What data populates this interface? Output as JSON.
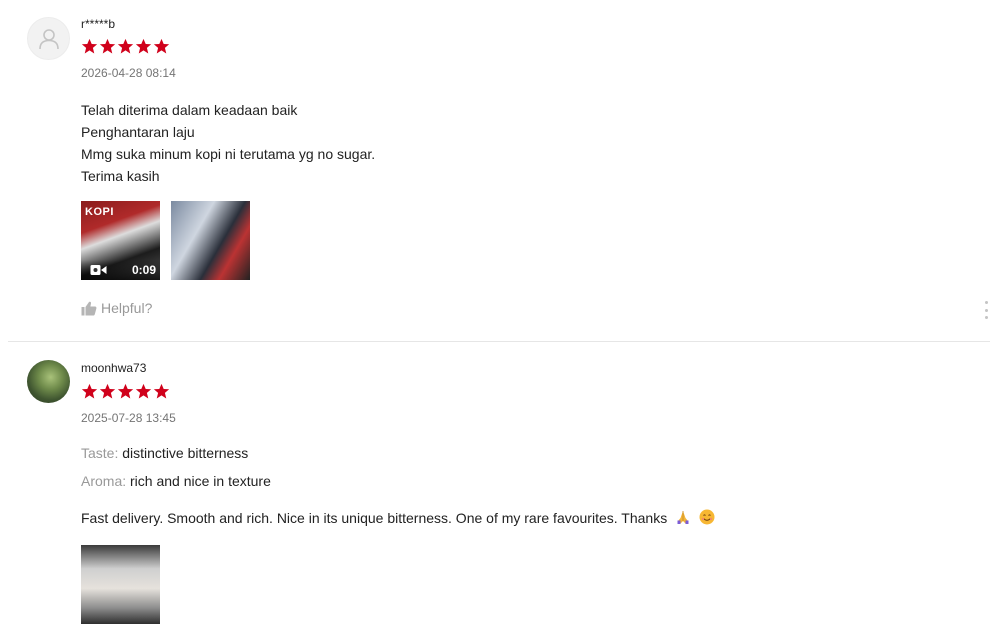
{
  "reviews": [
    {
      "username": "r*****b",
      "rating": 5,
      "date": "2026-04-28 08:14",
      "comment_lines": [
        "Telah diterima dalam keadaan baik",
        "Penghantaran laju",
        "Mmg suka minum kopi ni terutama yg no sugar.",
        "Terima kasih"
      ],
      "media": [
        {
          "type": "video",
          "duration": "0:09",
          "label": "KOPI"
        },
        {
          "type": "image"
        }
      ],
      "helpful_label": "Helpful?"
    },
    {
      "username": "moonhwa73",
      "rating": 5,
      "date": "2025-07-28 13:45",
      "attributes": [
        {
          "key": "Taste:",
          "value": "distinctive bitterness"
        },
        {
          "key": "Aroma:",
          "value": "rich and nice in texture"
        }
      ],
      "comment": "Fast delivery. Smooth and rich. Nice in its unique bitterness. One of my rare favourites. Thanks",
      "emojis": [
        "folded-hands-icon",
        "smiling-face-icon"
      ],
      "media": [
        {
          "type": "image"
        }
      ]
    }
  ],
  "colors": {
    "star": "#d0011b",
    "muted_text": "#999999",
    "date_text": "#757575",
    "divider": "#e6e6e6"
  }
}
